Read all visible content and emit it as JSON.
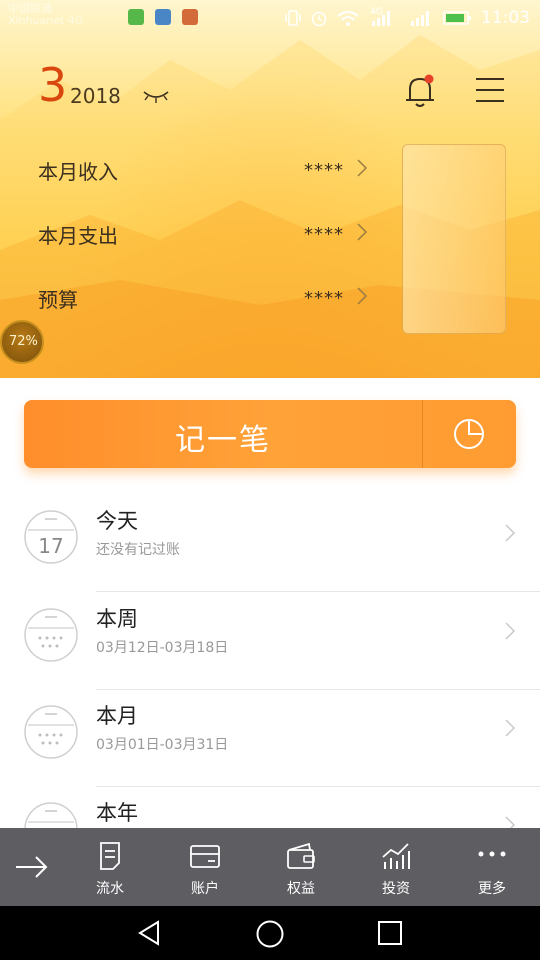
{
  "status_bar": {
    "carrier_line1": "中国联通",
    "carrier_line2": "Xinhuanet 4G",
    "network": "4G",
    "time": "11:03"
  },
  "header": {
    "month": "3",
    "year": "2018",
    "rows": [
      {
        "label": "本月收入",
        "value": "****"
      },
      {
        "label": "本月支出",
        "value": "****"
      },
      {
        "label": "预算",
        "value": "****"
      }
    ],
    "budget_percent": "72%"
  },
  "record_button": {
    "label": "记一笔"
  },
  "list": [
    {
      "title": "今天",
      "subtitle": "还没有记过账",
      "calendar_day": "17"
    },
    {
      "title": "本周",
      "subtitle": "03月12日-03月18日",
      "calendar_day": ""
    },
    {
      "title": "本月",
      "subtitle": "03月01日-03月31日",
      "calendar_day": ""
    },
    {
      "title": "本年",
      "subtitle": "",
      "calendar_day": ""
    }
  ],
  "tabbar": {
    "tabs": [
      {
        "label": "流水",
        "icon": "document-icon"
      },
      {
        "label": "账户",
        "icon": "card-icon"
      },
      {
        "label": "权益",
        "icon": "wallet-icon"
      },
      {
        "label": "投资",
        "icon": "chart-icon"
      },
      {
        "label": "更多",
        "icon": "more-icon"
      }
    ]
  },
  "colors": {
    "accent_orange": "#ff9530",
    "month_red": "#d9470e",
    "tabbar_bg": "#5d5d62"
  }
}
